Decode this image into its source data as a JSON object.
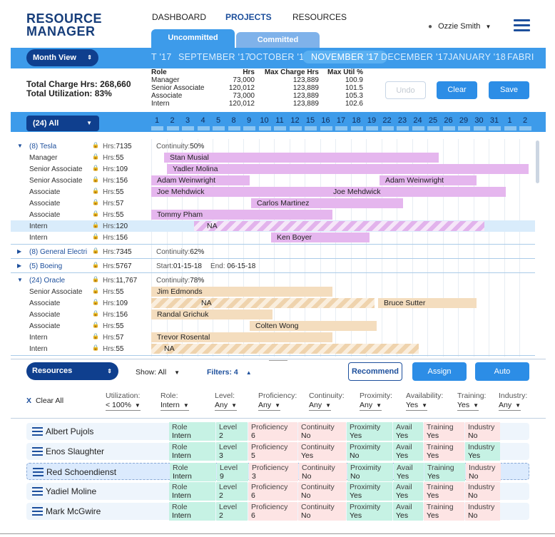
{
  "app": {
    "title_line1": "RESOURCE",
    "title_line2": "MANAGER"
  },
  "nav": {
    "dashboard": "DASHBOARD",
    "projects": "PROJECTS",
    "resources": "RESOURCES"
  },
  "tabs": {
    "uncommitted": "Uncommitted",
    "committed": "Committed"
  },
  "user": {
    "name": "Ozzie Smith"
  },
  "month_view": {
    "label": "Month View",
    "months": [
      "T '17",
      "SEPTEMBER '17",
      "OCTOBER '17",
      "NOVEMBER '17",
      "DECEMBER '17",
      "JANUARY '18",
      "FABRI"
    ],
    "active_month": "NOVEMBER '17"
  },
  "totals": {
    "charge": "Total Charge Hrs: 268,660",
    "utilization": "Total Utilization: 83%"
  },
  "summary": {
    "headers": [
      "Role",
      "Hrs",
      "Max Charge Hrs",
      "Max Util %"
    ],
    "rows": [
      [
        "Manager",
        "73,000",
        "123,889",
        "100.9"
      ],
      [
        "Senior Associate",
        "120,012",
        "123,889",
        "101.5"
      ],
      [
        "Associate",
        "73,000",
        "123,889",
        "105.3"
      ],
      [
        "Intern",
        "120,012",
        "123,889",
        "102.6"
      ]
    ]
  },
  "actions": {
    "undo": "Undo",
    "clear": "Clear",
    "save": "Save"
  },
  "filter_all": "(24) All",
  "days": [
    "1",
    "2",
    "3",
    "4",
    "5",
    "8",
    "9",
    "10",
    "11",
    "12",
    "15",
    "16",
    "17",
    "18",
    "19",
    "22",
    "23",
    "24",
    "25",
    "26",
    "29",
    "30",
    "31",
    "1",
    "2"
  ],
  "projects": [
    {
      "name": "(8) Tesla",
      "hrs": "7135",
      "info": "Continuity:",
      "info_val": "50%",
      "rows": [
        {
          "role": "Manager",
          "hrs": "55",
          "locked": false,
          "bar": "Stan Musial"
        },
        {
          "role": "Senior Associate",
          "hrs": "109",
          "locked": false,
          "bar": "Yadler Molina"
        },
        {
          "role": "Senior Associate",
          "hrs": "156",
          "locked": false,
          "bar": "Adam Weinwright",
          "bar2": "Adam Weinwright"
        },
        {
          "role": "Associate",
          "hrs": "55",
          "locked": false,
          "bar": "Joe Mehdwick",
          "bar2": "Joe Mehdwick"
        },
        {
          "role": "Associate",
          "hrs": "57",
          "locked": true,
          "bar": "Carlos Martinez"
        },
        {
          "role": "Associate",
          "hrs": "55",
          "locked": false,
          "bar": "Tommy Pham"
        },
        {
          "role": "Intern",
          "hrs": "120",
          "locked": true,
          "bar": "NA"
        },
        {
          "role": "Intern",
          "hrs": "156",
          "locked": false,
          "bar": "Ken Boyer"
        }
      ]
    },
    {
      "name": "(8) General Electri",
      "hrs": "7345",
      "info": "Continuity:",
      "info_val": "62%"
    },
    {
      "name": "(5) Boeing",
      "hrs": "5767",
      "info": "Start:",
      "info_val": "01-15-18",
      "info2": "End:",
      "info2_val": "06-15-18"
    },
    {
      "name": "(24) Oracle",
      "hrs": "11,767",
      "info": "Continuity:",
      "info_val": "78%",
      "rows": [
        {
          "role": "Senior Associate",
          "hrs": "55",
          "locked": false,
          "bar": "Jim Edmonds"
        },
        {
          "role": "Associate",
          "hrs": "109",
          "locked": false,
          "bar": "NA",
          "bar2": "Bruce Sutter"
        },
        {
          "role": "Associate",
          "hrs": "156",
          "locked": false,
          "bar": "Randal Grichuk"
        },
        {
          "role": "Associate",
          "hrs": "55",
          "locked": false,
          "bar": "Colten Wong"
        },
        {
          "role": "Intern",
          "hrs": "57",
          "locked": true,
          "bar": "Trevor Rosental"
        },
        {
          "role": "Intern",
          "hrs": "55",
          "locked": false,
          "bar": "NA"
        }
      ]
    }
  ],
  "hrs_label": "Hrs:",
  "resources_bar": {
    "label": "Resources",
    "show": "Show: All",
    "filters": "Filters: 4",
    "recommend": "Recommend",
    "assign": "Assign",
    "auto": "Auto"
  },
  "filters": {
    "clear_all": "Clear All",
    "items": [
      {
        "label": "Utilization:",
        "value": "< 100%"
      },
      {
        "label": "Role:",
        "value": "Intern"
      },
      {
        "label": "Level:",
        "value": "Any"
      },
      {
        "label": "Proficiency:",
        "value": "Any"
      },
      {
        "label": "Continuity:",
        "value": "Any"
      },
      {
        "label": "Proximity:",
        "value": "Any"
      },
      {
        "label": "Availability:",
        "value": "Yes"
      },
      {
        "label": "Training:",
        "value": "Yes"
      },
      {
        "label": "Industry:",
        "value": "Any"
      }
    ]
  },
  "resources": [
    {
      "name": "Albert Pujols",
      "role": "Intern",
      "level": "2",
      "proficiency": "6",
      "continuity": "No",
      "proximity": "Yes",
      "avail": "Yes",
      "training": "Yes",
      "industry": "No"
    },
    {
      "name": "Enos Slaughter",
      "role": "Intern",
      "level": "3",
      "proficiency": "5",
      "continuity": "Yes",
      "proximity": "No",
      "avail": "Yes",
      "training": "Yes",
      "industry": "Yes"
    },
    {
      "name": "Red Schoendienst",
      "role": "Intern",
      "level": "9",
      "proficiency": "3",
      "continuity": "No",
      "proximity": "No",
      "avail": "Yes",
      "training": "Yes",
      "industry": "No"
    },
    {
      "name": "Yadiel Moline",
      "role": "Intern",
      "level": "2",
      "proficiency": "6",
      "continuity": "No",
      "proximity": "Yes",
      "avail": "Yes",
      "training": "Yes",
      "industry": "No"
    },
    {
      "name": "Mark McGwire",
      "role": "Intern",
      "level": "2",
      "proficiency": "6",
      "continuity": "No",
      "proximity": "Yes",
      "avail": "Yes",
      "training": "Yes",
      "industry": "No"
    }
  ],
  "col_labels": {
    "role": "Role",
    "level": "Level",
    "proficiency": "Proficiency",
    "continuity": "Continuity",
    "proximity": "Proximity",
    "avail": "Avail",
    "training": "Training",
    "industry": "Industry"
  },
  "colors": {
    "accent": "#3d9bea",
    "brand": "#163d7a",
    "pink": "#e5b6ee",
    "tan": "#f4ddbe",
    "green": "#c6f2e4",
    "red": "#fde4e4"
  }
}
